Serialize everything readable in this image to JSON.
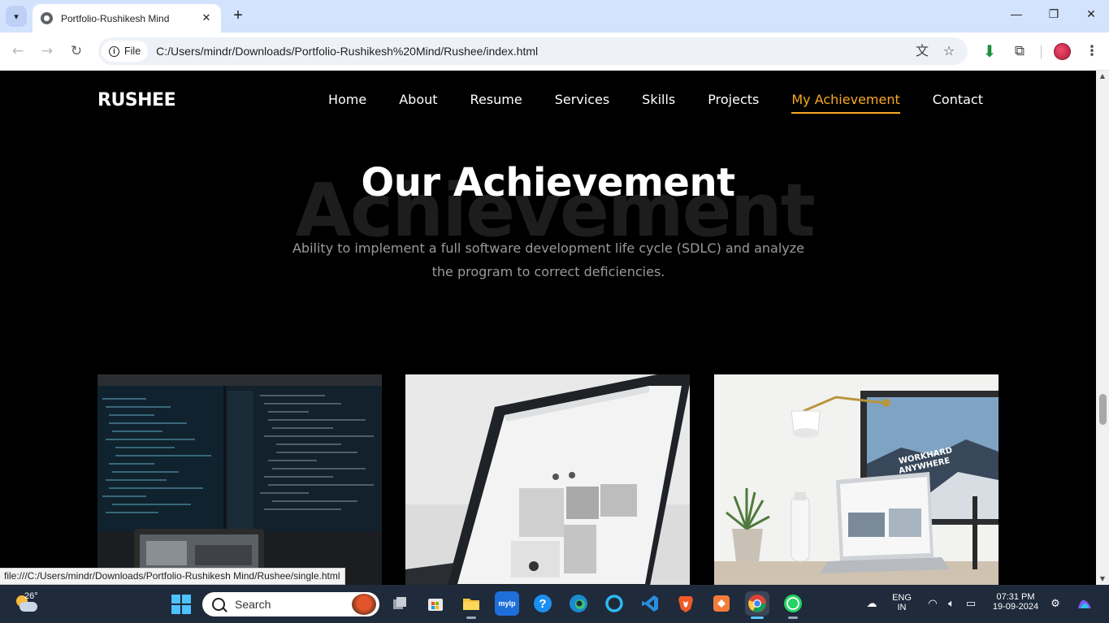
{
  "browser": {
    "tab_title": "Portfolio-Rushikesh Mind",
    "chip_label": "File",
    "url": "C:/Users/mindr/Downloads/Portfolio-Rushikesh%20Mind/Rushee/index.html",
    "status_link": "file:///C:/Users/mindr/Downloads/Portfolio-Rushikesh Mind/Rushee/single.html"
  },
  "site": {
    "logo": "RUSHEE",
    "nav": [
      {
        "label": "Home",
        "active": false
      },
      {
        "label": "About",
        "active": false
      },
      {
        "label": "Resume",
        "active": false
      },
      {
        "label": "Services",
        "active": false
      },
      {
        "label": "Skills",
        "active": false
      },
      {
        "label": "Projects",
        "active": false
      },
      {
        "label": "My Achievement",
        "active": true
      },
      {
        "label": "Contact",
        "active": false
      }
    ],
    "accent_color": "#f9a826",
    "section": {
      "background_word": "Achievement",
      "heading": "Our Achievement",
      "description": "Ability to implement a full software development life cycle (SDLC) and analyze the program to correct deficiencies."
    },
    "cards": [
      {
        "image": "code-monitors-photo"
      },
      {
        "image": "laptop-website-photo"
      },
      {
        "image": "desk-lamp-laptop-photo"
      }
    ],
    "card3_screen_text": [
      "WORKHARD",
      "ANYWHERE"
    ]
  },
  "taskbar": {
    "weather_temp": "26°",
    "search_label": "Search",
    "apps": [
      "task-view",
      "microsoft-store",
      "file-explorer",
      "mylp",
      "help",
      "edge",
      "cortana",
      "vscode",
      "brave",
      "app-orange",
      "chrome",
      "whatsapp"
    ],
    "language_line1": "ENG",
    "language_line2": "IN",
    "time": "07:31 PM",
    "date": "19-09-2024"
  }
}
